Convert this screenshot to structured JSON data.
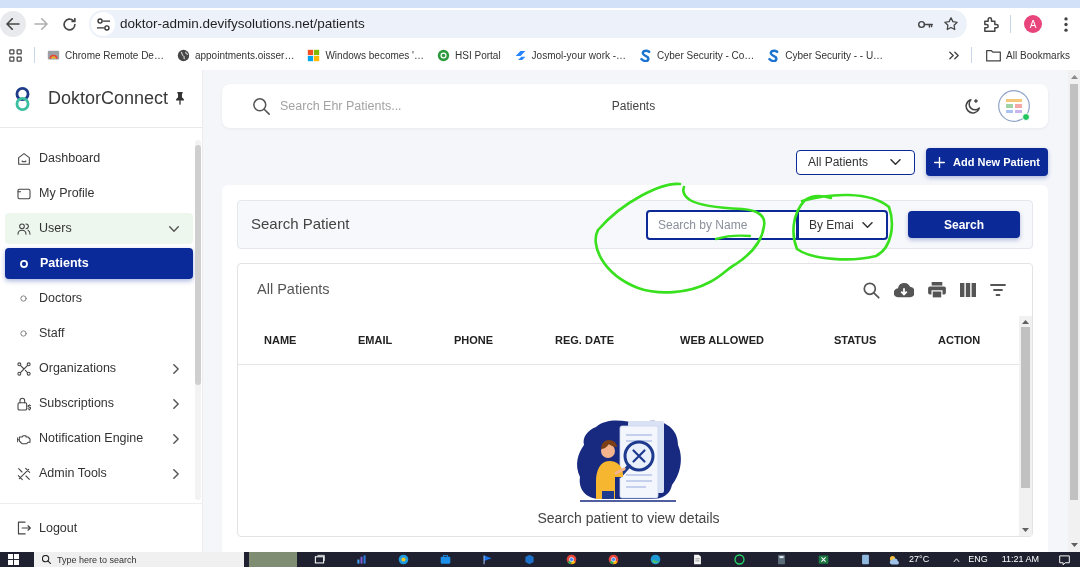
{
  "browser": {
    "url": "doktor-admin.devifysolutions.net/patients",
    "profile_initial": "A",
    "bookmarks": [
      {
        "label": "Chrome Remote De…"
      },
      {
        "label": "appointments.oisser…"
      },
      {
        "label": "Windows becomes '…"
      },
      {
        "label": "HSI Portal"
      },
      {
        "label": "Josmol-your work -…"
      },
      {
        "label": "Cyber Security - Co…"
      },
      {
        "label": "Cyber Security - - U…"
      }
    ],
    "all_bookmarks": "All Bookmarks"
  },
  "sidebar": {
    "brand": "DoktorConnect",
    "items": [
      {
        "label": "Dashboard",
        "kind": "link"
      },
      {
        "label": "My Profile",
        "kind": "link"
      },
      {
        "label": "Users",
        "kind": "group",
        "expanded": true,
        "children": [
          {
            "label": "Patients",
            "selected": true
          },
          {
            "label": "Doctors",
            "selected": false
          },
          {
            "label": "Staff",
            "selected": false
          }
        ]
      },
      {
        "label": "Organizations",
        "kind": "group",
        "expanded": false
      },
      {
        "label": "Subscriptions",
        "kind": "group",
        "expanded": false
      },
      {
        "label": "Notification Engine",
        "kind": "group",
        "expanded": false
      },
      {
        "label": "Admin Tools",
        "kind": "group",
        "expanded": false
      }
    ],
    "footer": {
      "label": "Logout"
    }
  },
  "header": {
    "search": {
      "placeholder": "Search Ehr Patients..."
    },
    "title": "Patients",
    "online": true
  },
  "toolbar": {
    "filter": {
      "value": "All Patients"
    },
    "add_button": "Add New Patient"
  },
  "search_panel": {
    "title": "Search Patient",
    "name_field": {
      "placeholder": "Search by Name",
      "circled": true
    },
    "type_select": {
      "value": "By Emai",
      "circled": true
    },
    "button": "Search"
  },
  "patients_table": {
    "title": "All Patients",
    "columns": [
      "NAME",
      "EMAIL",
      "PHONE",
      "REG. DATE",
      "WEB ALLOWED",
      "STATUS",
      "ACTION"
    ],
    "empty_message": "Search patient to view details"
  },
  "taskbar": {
    "search_placeholder": "Type here to search",
    "weather": "27°C",
    "language": "ENG",
    "time": "11:21 AM"
  }
}
